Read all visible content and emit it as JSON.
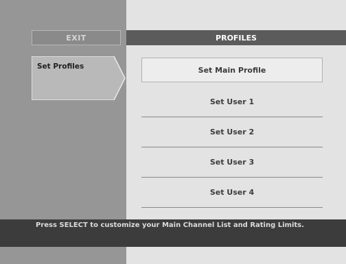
{
  "left_nav": {
    "exit_label": "EXIT",
    "active_item_label": "Set Profiles"
  },
  "header": {
    "title": "PROFILES"
  },
  "menu": {
    "items": [
      {
        "label": "Set Main Profile",
        "selected": true
      },
      {
        "label": "Set User 1",
        "selected": false
      },
      {
        "label": "Set User 2",
        "selected": false
      },
      {
        "label": "Set User 3",
        "selected": false
      },
      {
        "label": "Set User 4",
        "selected": false
      }
    ]
  },
  "status": {
    "help_text": "Press SELECT to customize your Main Channel List and Rating Limits."
  },
  "colors": {
    "left_panel": "#969696",
    "right_panel": "#e3e3e3",
    "header_bar": "#5b5b5b",
    "status_bar": "#3c3c3c"
  }
}
